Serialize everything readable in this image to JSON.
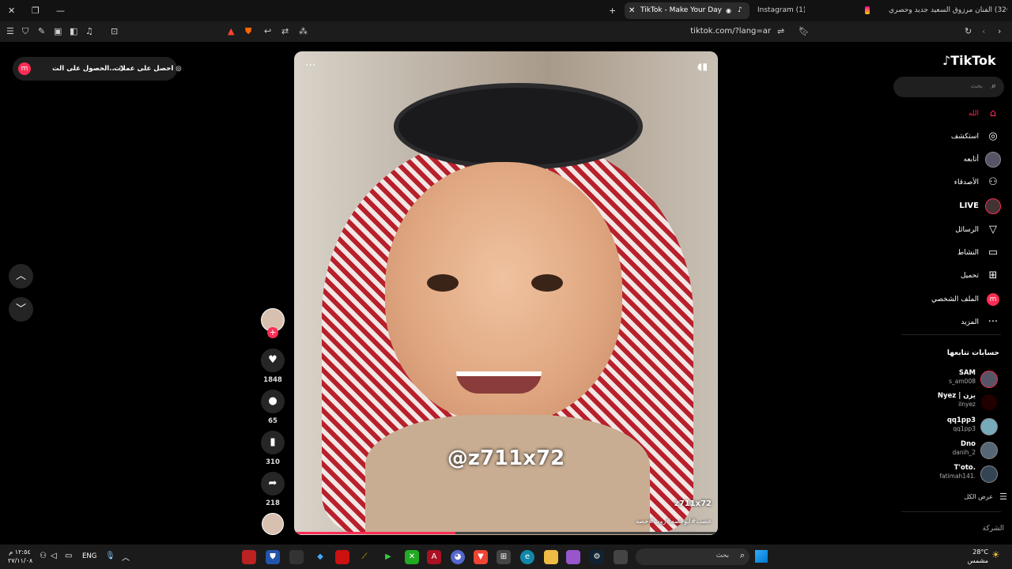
{
  "browser": {
    "tabs": [
      {
        "title": "(326) الفنان مرزوق السعيد جديد وحصري",
        "active": false
      },
      {
        "title": "Instagram (1)",
        "active": false
      },
      {
        "title": "TikTok - Make Your Day",
        "active": true
      }
    ],
    "url": "tiktok.com/?lang=ar"
  },
  "promo": {
    "label_left": "الحصول على الت...",
    "label_right": "احصل على عملات",
    "avatar_letter": "m"
  },
  "video": {
    "watermark": "@z711x72",
    "author": "z711x72",
    "caption": "عصب#ابوحصه#روب#حصه"
  },
  "actions": {
    "likes": "1848",
    "comments": "65",
    "saves": "310",
    "shares": "218"
  },
  "sidebar": {
    "logo": "TikTok",
    "search_placeholder": "بحث",
    "nav": [
      {
        "label": "الله",
        "icon": "home-icon"
      },
      {
        "label": "استكشف",
        "icon": "compass-icon"
      },
      {
        "label": "أتابعه",
        "icon": "following-icon"
      },
      {
        "label": "الأصدقاء",
        "icon": "friends-icon"
      },
      {
        "label": "LIVE",
        "icon": "live-icon"
      },
      {
        "label": "الرسائل",
        "icon": "send-icon"
      },
      {
        "label": "النشاط",
        "icon": "activity-icon"
      },
      {
        "label": "تحميل",
        "icon": "upload-icon"
      },
      {
        "label": "الملف الشخصي",
        "icon": "profile-icon"
      },
      {
        "label": "المزيد",
        "icon": "more-icon"
      }
    ],
    "following_title": "حسابات تتابعها",
    "accounts": [
      {
        "name": "SAM",
        "user": "s_am008"
      },
      {
        "name": "Nyez | يزن",
        "user": "ilnyez"
      },
      {
        "name": "qq1pp3",
        "user": "qq1pp3"
      },
      {
        "name": "Dno",
        "user": "danih_2"
      },
      {
        "name": "T'oto.",
        "user": "fatimah141."
      }
    ],
    "show_all": "عرض الكل",
    "company": "الشركة"
  },
  "taskbar": {
    "time": "١٢:٥٤ م",
    "date": "٢٧/١١/٠٨",
    "lang": "ENG",
    "weather_temp": "28°C",
    "weather_desc": "مشمس",
    "search_placeholder": "بحث"
  },
  "colors": {
    "brand_pink": "#fe2c55",
    "tab_bg": "#121212",
    "toolbar_bg": "#1c1c1c",
    "taskbar_bg": "#1b1b1b"
  }
}
